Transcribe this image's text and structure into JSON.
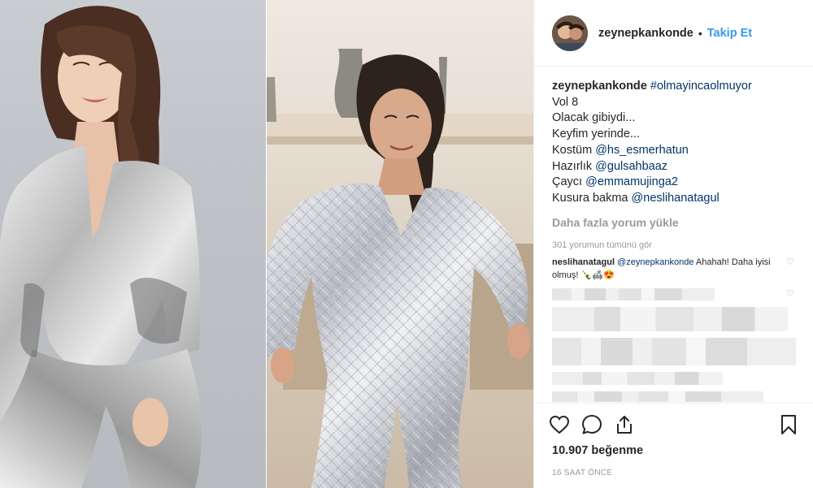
{
  "post": {
    "username": "zeynepkankonde",
    "separator": "•",
    "follow_label": "Takip Et",
    "caption": {
      "hashtag": "#olmayincaolmuyor",
      "lines": [
        "Vol 8",
        "Olacak gibiydi...",
        "Keyfim yerinde..."
      ],
      "credit_1_label": "Kostüm ",
      "credit_1_user": "@hs_esmerhatun",
      "credit_2_label": "Hazırlık ",
      "credit_2_user": "@gulsahbaaz",
      "credit_3_label": "Çaycı ",
      "credit_3_user": "@emmamujinga2",
      "credit_4_label": "Kusura bakma ",
      "credit_4_user": "@neslihanatagul"
    },
    "load_more_label": "Daha fazla yorum yükle",
    "view_all_label": "301 yorumun tümünü gör",
    "top_comment": {
      "username": "neslihanatagul",
      "mention": "@zeynepkankonde",
      "text": " Ahahah! Daha iyisi olmuş! 🍾🛋😍"
    },
    "likes_label": "10.907 beğenme",
    "time_label": "16 SAAT ÖNCE"
  },
  "icons": {
    "like": "heart-icon",
    "comment": "comment-icon",
    "share": "share-icon",
    "save": "bookmark-icon",
    "comment_like": "heart-icon"
  },
  "colors": {
    "link": "#3897f0",
    "mention": "#003569",
    "muted": "#999999",
    "text": "#262626",
    "border": "#efefef"
  }
}
